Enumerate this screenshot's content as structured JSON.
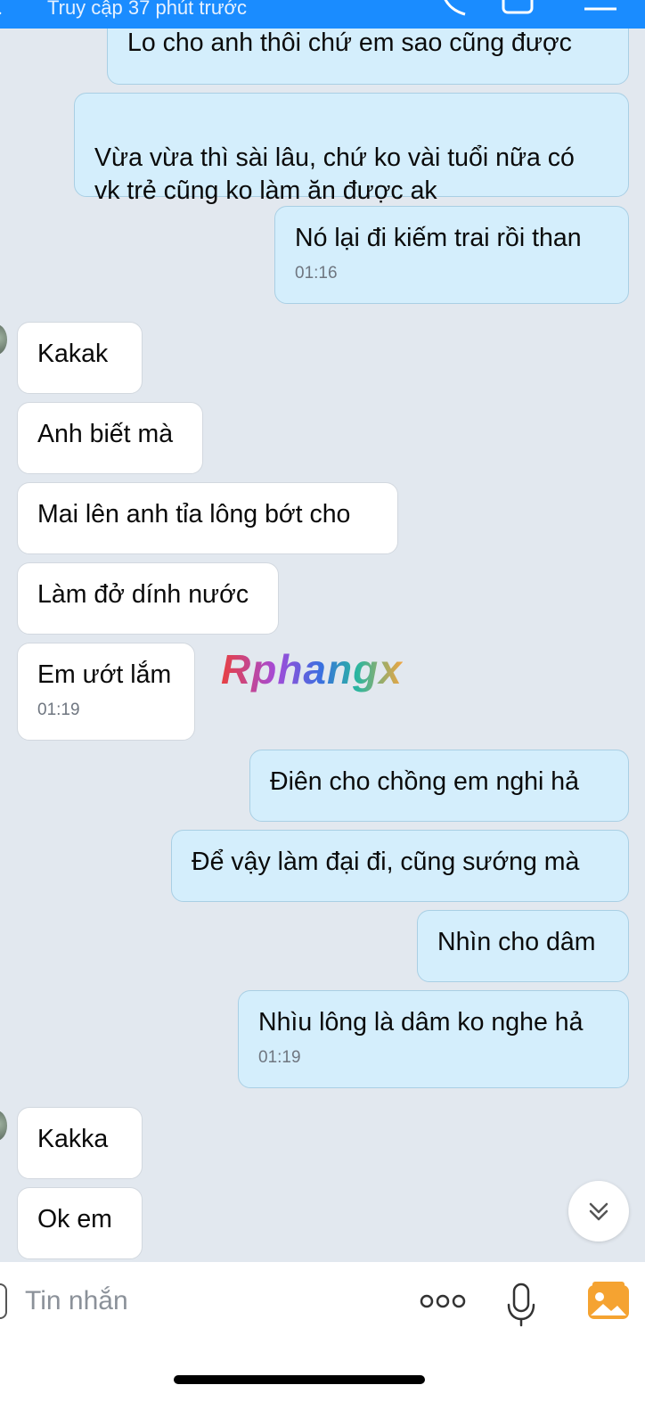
{
  "header": {
    "status": "Truy cập 37 phút trước"
  },
  "messages": [
    {
      "side": "me",
      "text": "Lo cho anh thôi chứ em sao cũng được",
      "time": ""
    },
    {
      "side": "me",
      "text": "Vừa vừa thì sài lâu, chứ ko vài tuổi nữa có\nvk trẻ cũng ko làm ăn được ak",
      "time": ""
    },
    {
      "side": "me",
      "text": "Nó lại đi kiếm trai rồi than",
      "time": "01:16"
    },
    {
      "side": "them",
      "text": "Kakak",
      "time": ""
    },
    {
      "side": "them",
      "text": "Anh biết mà",
      "time": ""
    },
    {
      "side": "them",
      "text": "Mai lên anh tỉa lông bớt cho",
      "time": ""
    },
    {
      "side": "them",
      "text": "Làm đở dính nước",
      "time": ""
    },
    {
      "side": "them",
      "text": "Em ướt lắm",
      "time": "01:19"
    },
    {
      "side": "me",
      "text": "Điên cho chồng em nghi hả",
      "time": ""
    },
    {
      "side": "me",
      "text": "Để vậy làm đại đi, cũng sướng mà",
      "time": ""
    },
    {
      "side": "me",
      "text": "Nhìn cho dâm",
      "time": ""
    },
    {
      "side": "me",
      "text": "Nhìu lông là dâm ko nghe hả",
      "time": "01:19"
    },
    {
      "side": "them",
      "text": "Kakka",
      "time": ""
    },
    {
      "side": "them",
      "text": "Ok em",
      "time": ""
    }
  ],
  "watermark": "Rphangx",
  "composer": {
    "placeholder": "Tin nhắn"
  },
  "icons": {
    "back": "back-icon",
    "more": "more-options-icon",
    "mic": "microphone-icon",
    "image": "image-icon",
    "scroll": "chevron-double-down-icon"
  },
  "colors": {
    "header_bg": "#1a8cff",
    "chat_bg": "#e2e8ef",
    "my_bubble": "#d4eefc",
    "their_bubble": "#ffffff",
    "image_icon": "#f5a331"
  }
}
